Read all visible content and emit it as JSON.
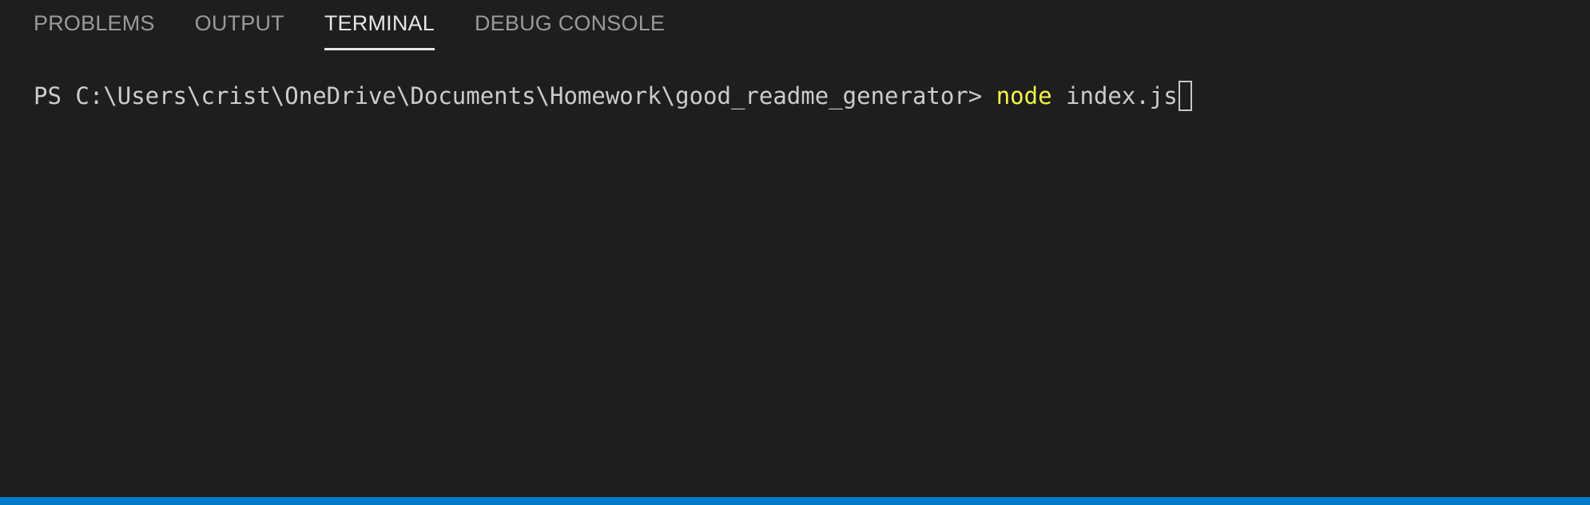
{
  "tabs": [
    {
      "label": "PROBLEMS",
      "active": false
    },
    {
      "label": "OUTPUT",
      "active": false
    },
    {
      "label": "TERMINAL",
      "active": true
    },
    {
      "label": "DEBUG CONSOLE",
      "active": false
    }
  ],
  "terminal": {
    "prompt": "PS C:\\Users\\crist\\OneDrive\\Documents\\Homework\\good_readme_generator> ",
    "command": "node",
    "args": " index.js"
  },
  "colors": {
    "background": "#1e1e1e",
    "command_highlight": "#f5f543",
    "status_bar": "#007acc"
  }
}
